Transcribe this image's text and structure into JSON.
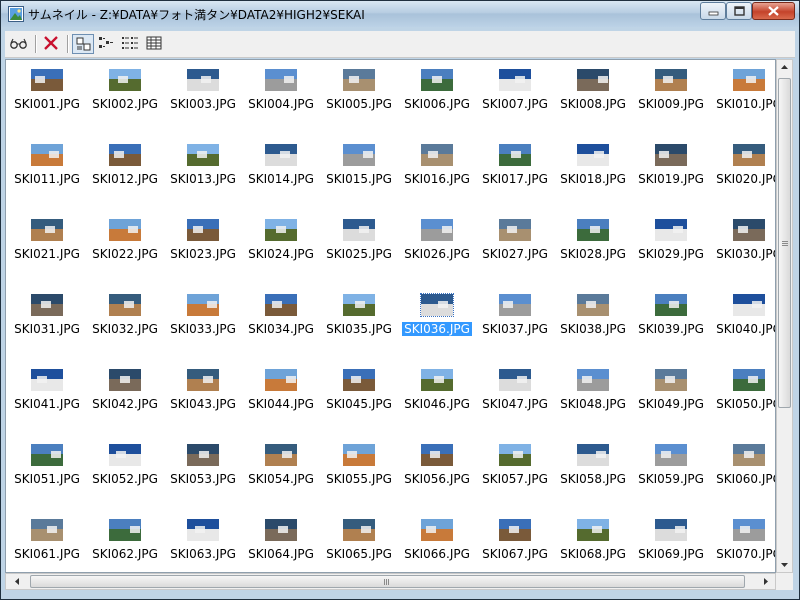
{
  "window": {
    "title": "サムネイル - Z:¥DATA¥フォト満タン¥DATA2¥HIGH2¥SEKAI",
    "app_icon": "image-icon",
    "buttons": [
      {
        "name": "minimize-button",
        "icon": "minimize-icon"
      },
      {
        "name": "maximize-button",
        "icon": "maximize-icon"
      },
      {
        "name": "close-button",
        "icon": "close-icon"
      }
    ]
  },
  "toolbar": {
    "tools": [
      {
        "name": "view-glasses-button",
        "icon": "glasses-icon"
      },
      {
        "name": "delete-button",
        "icon": "red-x-icon"
      },
      {
        "name": "view-large-icons-button",
        "icon": "large-icons-view-icon",
        "selected": true
      },
      {
        "name": "view-small-icons-button",
        "icon": "small-icons-view-icon"
      },
      {
        "name": "view-list-button",
        "icon": "list-view-icon"
      },
      {
        "name": "view-details-button",
        "icon": "details-view-icon"
      }
    ]
  },
  "thumbnails": {
    "selected": "SKI036.JPG",
    "items": [
      "SKI001.JPG",
      "SKI002.JPG",
      "SKI003.JPG",
      "SKI004.JPG",
      "SKI005.JPG",
      "SKI006.JPG",
      "SKI007.JPG",
      "SKI008.JPG",
      "SKI009.JPG",
      "SKI010.JPG",
      "SKI011.JPG",
      "SKI012.JPG",
      "SKI013.JPG",
      "SKI014.JPG",
      "SKI015.JPG",
      "SKI016.JPG",
      "SKI017.JPG",
      "SKI018.JPG",
      "SKI019.JPG",
      "SKI020.JPG",
      "SKI021.JPG",
      "SKI022.JPG",
      "SKI023.JPG",
      "SKI024.JPG",
      "SKI025.JPG",
      "SKI026.JPG",
      "SKI027.JPG",
      "SKI028.JPG",
      "SKI029.JPG",
      "SKI030.JPG",
      "SKI031.JPG",
      "SKI032.JPG",
      "SKI033.JPG",
      "SKI034.JPG",
      "SKI035.JPG",
      "SKI036.JPG",
      "SKI037.JPG",
      "SKI038.JPG",
      "SKI039.JPG",
      "SKI040.JPG",
      "SKI041.JPG",
      "SKI042.JPG",
      "SKI043.JPG",
      "SKI044.JPG",
      "SKI045.JPG",
      "SKI046.JPG",
      "SKI047.JPG",
      "SKI048.JPG",
      "SKI049.JPG",
      "SKI050.JPG",
      "SKI051.JPG",
      "SKI052.JPG",
      "SKI053.JPG",
      "SKI054.JPG",
      "SKI055.JPG",
      "SKI056.JPG",
      "SKI057.JPG",
      "SKI058.JPG",
      "SKI059.JPG",
      "SKI060.JPG",
      "SKI061.JPG",
      "SKI062.JPG",
      "SKI063.JPG",
      "SKI064.JPG",
      "SKI065.JPG",
      "SKI066.JPG",
      "SKI067.JPG",
      "SKI068.JPG",
      "SKI069.JPG",
      "SKI070.JPG"
    ]
  },
  "colors": {
    "selection": "#3399ff",
    "titlebar": "#bcd2e6",
    "close_button": "#c4432b"
  }
}
